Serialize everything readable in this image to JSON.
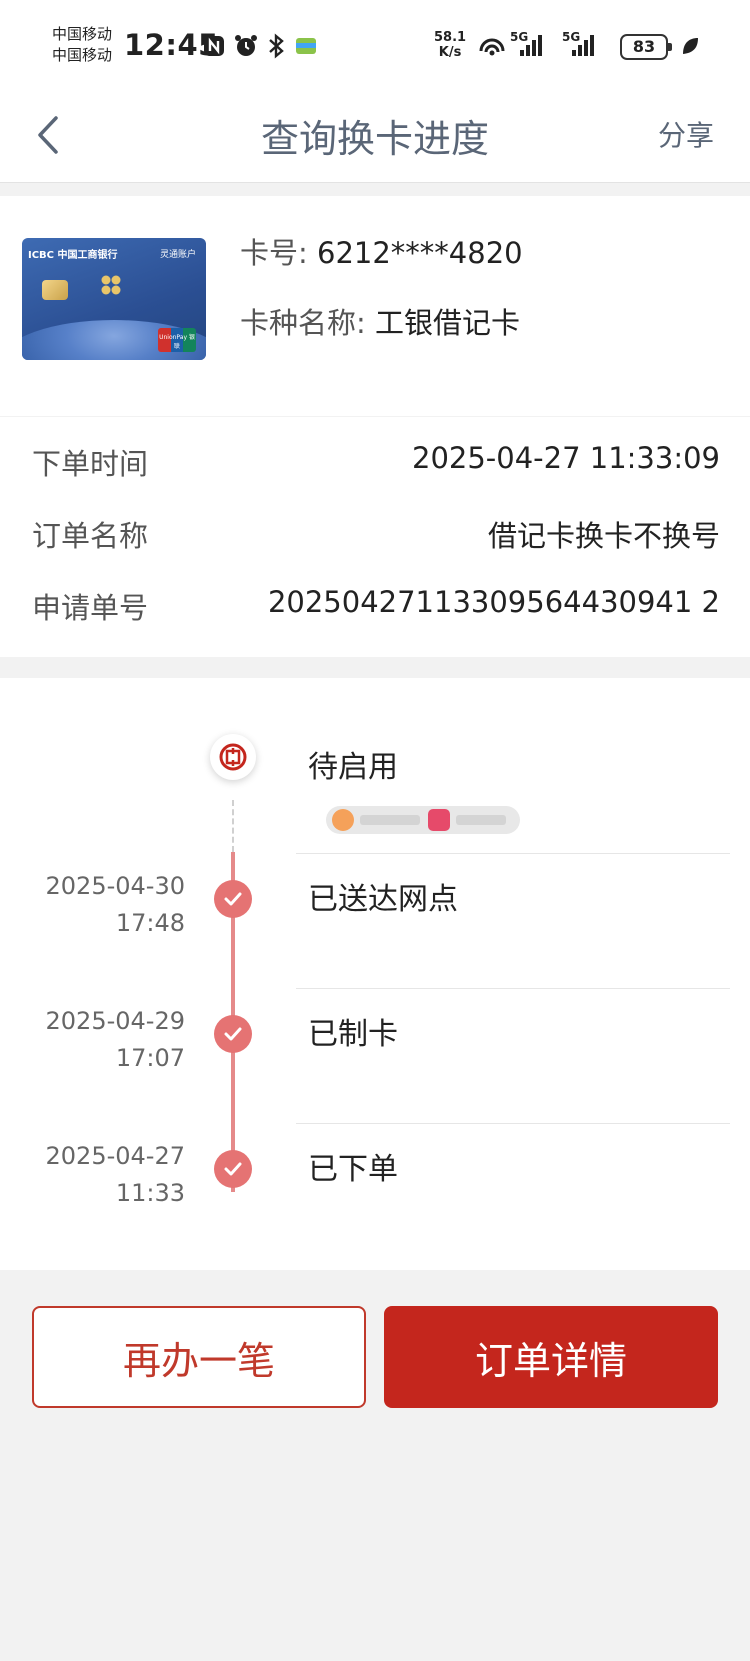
{
  "status_bar": {
    "carrier_1": "中国移动",
    "carrier_2": "中国移动",
    "time": "12:45",
    "net_speed_value": "58.1",
    "net_speed_unit": "K/s",
    "battery": "83",
    "signal_1_label": "5G",
    "signal_2_label": "5G"
  },
  "nav": {
    "title": "查询换卡进度",
    "share_label": "分享"
  },
  "card": {
    "number_label": "卡号:",
    "number_value": "6212****4820",
    "type_label": "卡种名称:",
    "type_value": "工银借记卡",
    "image_bank_text": "ICBC 中国工商银行",
    "image_corner_text": "灵通账户",
    "image_unionpay": "UnionPay 银联"
  },
  "order": {
    "time_label": "下单时间",
    "time_value": "2025-04-27 11:33:09",
    "name_label": "订单名称",
    "name_value": "借记卡换卡不换号",
    "id_label": "申请单号",
    "id_value": "20250427113309564430941 2"
  },
  "timeline": [
    {
      "status": "待启用",
      "date": "",
      "time": "",
      "icon": "icbc-logo-icon"
    },
    {
      "status": "已送达网点",
      "date": "2025-04-30",
      "time": "17:48",
      "icon": "check-icon"
    },
    {
      "status": "已制卡",
      "date": "2025-04-29",
      "time": "17:07",
      "icon": "check-icon"
    },
    {
      "status": "已下单",
      "date": "2025-04-27",
      "time": "11:33",
      "icon": "check-icon"
    }
  ],
  "buttons": {
    "again_label": "再办一笔",
    "detail_label": "订单详情"
  },
  "colors": {
    "accent": "#c4261d",
    "timeline": "#e57373",
    "title": "#5a6677"
  }
}
